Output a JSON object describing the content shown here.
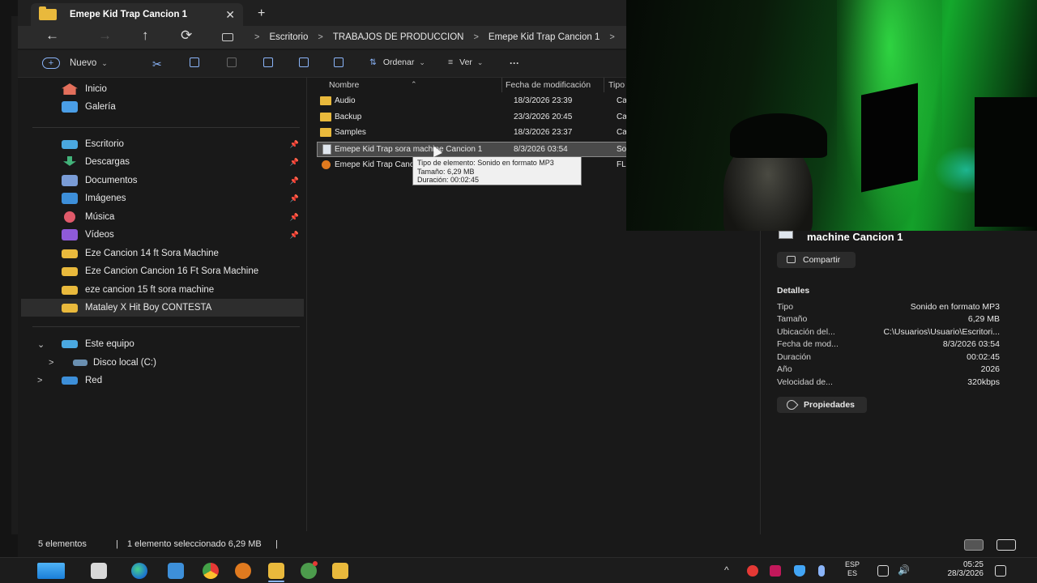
{
  "tab": {
    "title": "Emepe Kid Trap Cancion 1",
    "close": "✕",
    "new": "+"
  },
  "nav": {
    "back": "←",
    "forward": "→",
    "up": "↑",
    "refresh": "⟳"
  },
  "breadcrumb": [
    "Escritorio",
    "TRABAJOS DE PRODUCCION",
    "Emepe Kid Trap Cancion 1"
  ],
  "breadcrumb_sep": ">",
  "commands": {
    "new_label": "Nuevo",
    "sort_label": "Ordenar",
    "view_label": "Ver",
    "more": "···"
  },
  "sidebar": {
    "quick": [
      {
        "label": "Inicio",
        "icon": "home-icon"
      },
      {
        "label": "Galería",
        "icon": "gallery-icon"
      }
    ],
    "pinned": [
      {
        "label": "Escritorio",
        "icon": "desktop-icon"
      },
      {
        "label": "Descargas",
        "icon": "download-icon"
      },
      {
        "label": "Documentos",
        "icon": "documents-icon"
      },
      {
        "label": "Imágenes",
        "icon": "pictures-icon"
      },
      {
        "label": "Música",
        "icon": "music-icon"
      },
      {
        "label": "Vídeos",
        "icon": "videos-icon"
      }
    ],
    "folders": [
      "Eze Cancion 14 ft Sora Machine",
      "Eze Cancion Cancion 16 Ft Sora Machine",
      "eze cancion 15 ft sora machine",
      "Mataley X Hit Boy CONTESTA"
    ],
    "this_pc": "Este equipo",
    "disk": "Disco local (C:)",
    "network": "Red"
  },
  "columns": {
    "name": "Nombre",
    "modified": "Fecha de modificación",
    "type": "Tipo"
  },
  "files": [
    {
      "name": "Audio",
      "modified": "18/3/2026 23:39",
      "type": "Carp",
      "icon": "folder-icon"
    },
    {
      "name": "Backup",
      "modified": "23/3/2026 20:45",
      "type": "Carp",
      "icon": "folder-icon"
    },
    {
      "name": "Samples",
      "modified": "18/3/2026 23:37",
      "type": "Carp",
      "icon": "folder-icon"
    },
    {
      "name": "Emepe Kid Trap  sora machine Cancion 1",
      "modified": "8/3/2026 03:54",
      "type": "Sonic",
      "icon": "mp3-file-icon"
    },
    {
      "name": "Emepe Kid Trap Canc",
      "modified": "",
      "type": "FL St",
      "icon": "fl-studio-file-icon"
    }
  ],
  "tooltip": {
    "line1": "Tipo de elemento: Sonido en formato MP3",
    "line2": "Tamaño: 6,29 MB",
    "line3": "Duración: 00:02:45"
  },
  "details": {
    "title": "machine Cancion 1",
    "share": "Compartir",
    "heading": "Detalles",
    "rows": [
      {
        "key": "Tipo",
        "value": "Sonido en formato MP3"
      },
      {
        "key": "Tamaño",
        "value": "6,29 MB"
      },
      {
        "key": "Ubicación del...",
        "value": "C:\\Usuarios\\Usuario\\Escritori..."
      },
      {
        "key": "Fecha de mod...",
        "value": "8/3/2026 03:54"
      },
      {
        "key": "Duración",
        "value": "00:02:45"
      },
      {
        "key": "Año",
        "value": "2026"
      },
      {
        "key": "Velocidad de...",
        "value": "320kbps"
      }
    ],
    "properties": "Propiedades"
  },
  "status": {
    "count": "5 elementos",
    "selected": "1 elemento seleccionado  6,29 MB",
    "sep": "|"
  },
  "taskbar": {
    "lang1": "ESP",
    "lang2": "ES",
    "time": "05:25",
    "date": "28/3/2026",
    "chevron": "^"
  },
  "colors": {
    "accent": "#8ab4f8",
    "folder": "#e9b93c",
    "background": "#191919"
  }
}
